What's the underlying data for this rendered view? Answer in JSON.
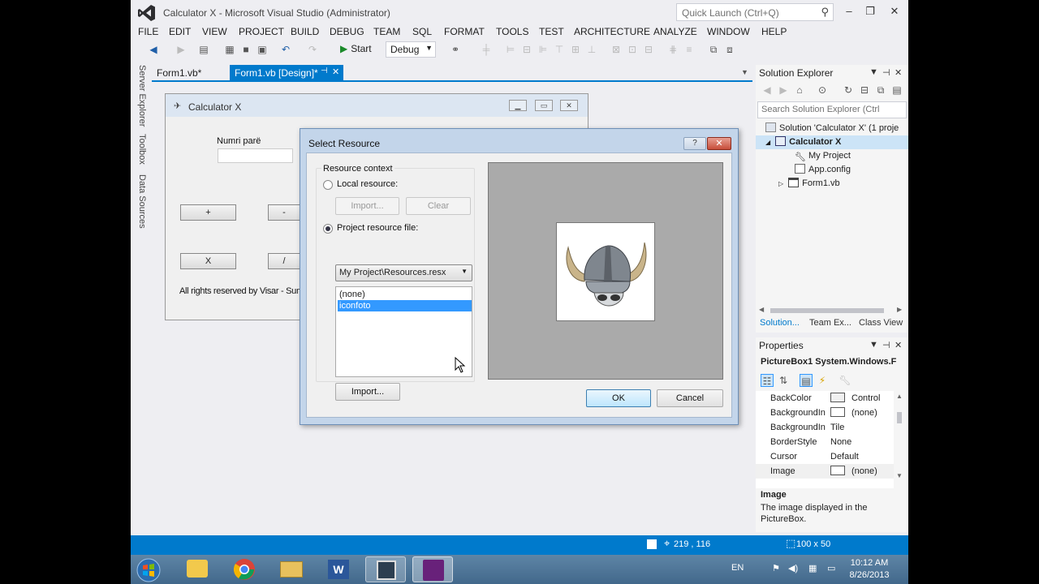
{
  "window": {
    "title": "Calculator X - Microsoft Visual Studio (Administrator)",
    "quick_launch_placeholder": "Quick Launch (Ctrl+Q)"
  },
  "menu": [
    "FILE",
    "EDIT",
    "VIEW",
    "PROJECT",
    "BUILD",
    "DEBUG",
    "TEAM",
    "SQL",
    "FORMAT",
    "TOOLS",
    "TEST",
    "ARCHITECTURE",
    "ANALYZE",
    "WINDOW",
    "HELP"
  ],
  "toolbar": {
    "start_label": "Start",
    "config": "Debug"
  },
  "side_tabs": [
    "Server Explorer",
    "Toolbox",
    "Data Sources"
  ],
  "doc_tabs": [
    {
      "label": "Form1.vb*",
      "active": false
    },
    {
      "label": "Form1.vb [Design]*",
      "active": true
    }
  ],
  "form": {
    "title": "Calculator X",
    "label_numri": "Numri parë",
    "buttons": [
      "+",
      "-",
      "X",
      "/"
    ],
    "footer": "All rights reserved by Visar - Summ"
  },
  "dialog": {
    "title": "Select Resource",
    "help": "?",
    "group_label": "Resource context",
    "local_resource": "Local resource:",
    "import_disabled": "Import...",
    "clear": "Clear",
    "project_resource": "Project resource file:",
    "resource_file": "My Project\\Resources.resx",
    "list_items": [
      "(none)",
      "iconfoto"
    ],
    "selected_item": "iconfoto",
    "import": "Import...",
    "ok": "OK",
    "cancel": "Cancel"
  },
  "solution_explorer": {
    "title": "Solution Explorer",
    "search_placeholder": "Search Solution Explorer (Ctrl",
    "tree": [
      {
        "label": "Solution 'Calculator X' (1 proje",
        "indent": 0,
        "icon": "solution-icon"
      },
      {
        "label": "Calculator X",
        "indent": 1,
        "icon": "vb-project-icon",
        "selected": true
      },
      {
        "label": "My Project",
        "indent": 2,
        "icon": "wrench-icon"
      },
      {
        "label": "App.config",
        "indent": 2,
        "icon": "config-icon"
      },
      {
        "label": "Form1.vb",
        "indent": 2,
        "icon": "form-icon"
      }
    ],
    "bottom_tabs": [
      "Solution...",
      "Team Ex...",
      "Class View"
    ]
  },
  "properties": {
    "title": "Properties",
    "object": "PictureBox1  System.Windows.F",
    "rows": [
      {
        "name": "BackColor",
        "value": "Control",
        "swatch": true
      },
      {
        "name": "BackgroundIn",
        "value": "(none)",
        "swatch": true
      },
      {
        "name": "BackgroundIn",
        "value": "Tile",
        "swatch": false
      },
      {
        "name": "BorderStyle",
        "value": "None",
        "swatch": false
      },
      {
        "name": "Cursor",
        "value": "Default",
        "swatch": false
      },
      {
        "name": "Image",
        "value": "(none)",
        "swatch": true,
        "highlight": true
      }
    ],
    "desc_title": "Image",
    "desc_text": "The image displayed in the PictureBox."
  },
  "status": {
    "position": "219 , 116",
    "size": "100 x 50"
  },
  "taskbar": {
    "lang": "EN",
    "time": "10:12 AM",
    "date": "8/26/2013"
  },
  "colors": {
    "accent": "#007acc",
    "dialog_frame": "#c3d5ea",
    "selection": "#3399ff"
  }
}
